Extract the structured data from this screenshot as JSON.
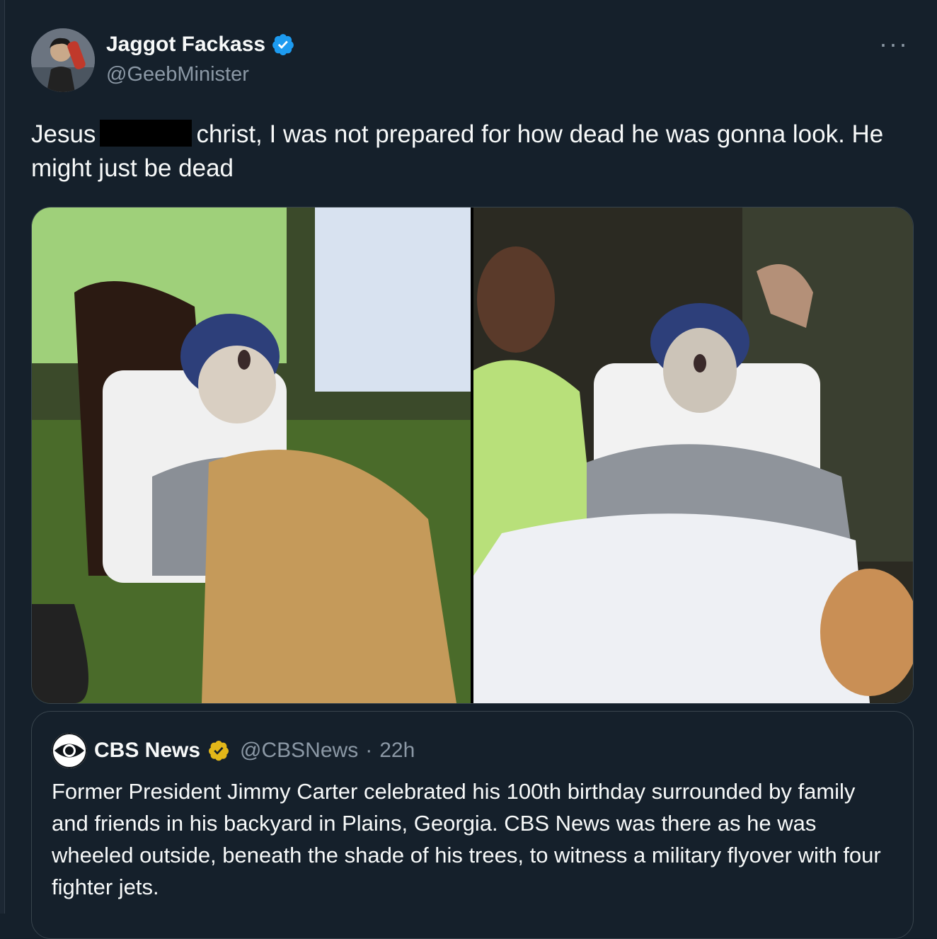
{
  "author": {
    "display_name": "Jaggot Fackass",
    "handle": "@GeebMinister",
    "verified_icon": "verified-badge-blue"
  },
  "more_menu": "···",
  "tweet": {
    "text_part1": "Jesus",
    "text_part2": "christ, I was not prepared for how dead he was gonna look. He might just be dead"
  },
  "quoted": {
    "source_name": "CBS News",
    "handle": "@CBSNews",
    "separator": "·",
    "time": "22h",
    "verified_icon": "verified-badge-gold",
    "body": "Former President Jimmy Carter celebrated his 100th birthday surrounded by family and friends in his backyard in Plains, Georgia. CBS News was there as he was wheeled outside, beneath the shade of his trees, to witness a military flyover with four fighter jets."
  },
  "colors": {
    "background": "#15202b",
    "text": "#f7f9f9",
    "muted": "#8b98a5",
    "verified_blue": "#1d9bf0",
    "verified_gold": "#e2b719"
  }
}
